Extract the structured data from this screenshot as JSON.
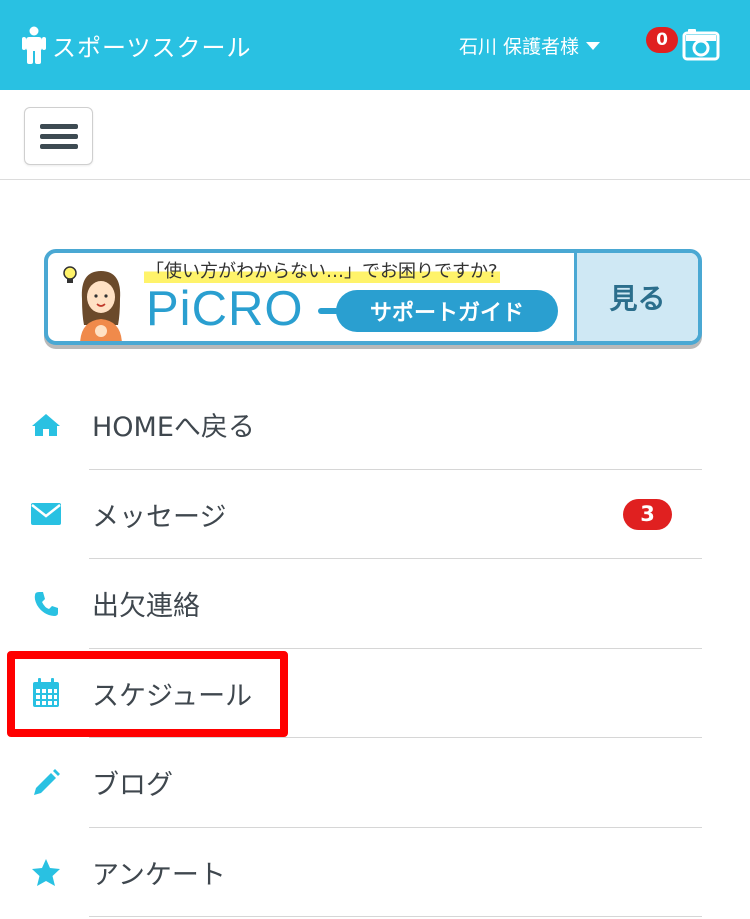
{
  "header": {
    "app_title": "スポーツスクール",
    "user_name": "石川 保護者様",
    "notification_count": "0",
    "brand_icon": "person-icon",
    "camera_icon": "camera-icon",
    "color": "#29c1e2"
  },
  "toolbar": {
    "menu_icon": "hamburger-icon"
  },
  "banner": {
    "lead_text": "「使い方がわからない…」でお困りですか?",
    "logo_text": "PiCRO",
    "guide_text": "サポートガイド",
    "button_text": "見る"
  },
  "menu": {
    "items": [
      {
        "label": "HOMEへ戻る",
        "icon": "home-icon"
      },
      {
        "label": "メッセージ",
        "icon": "envelope-icon",
        "badge": "3"
      },
      {
        "label": "出欠連絡",
        "icon": "phone-icon"
      },
      {
        "label": "スケジュール",
        "icon": "calendar-icon",
        "highlighted": true
      },
      {
        "label": "ブログ",
        "icon": "pencil-icon"
      },
      {
        "label": "アンケート",
        "icon": "star-icon"
      }
    ],
    "icon_color": "#29c1e2",
    "badge_color": "#e02020",
    "highlight_color": "#ff0000"
  }
}
